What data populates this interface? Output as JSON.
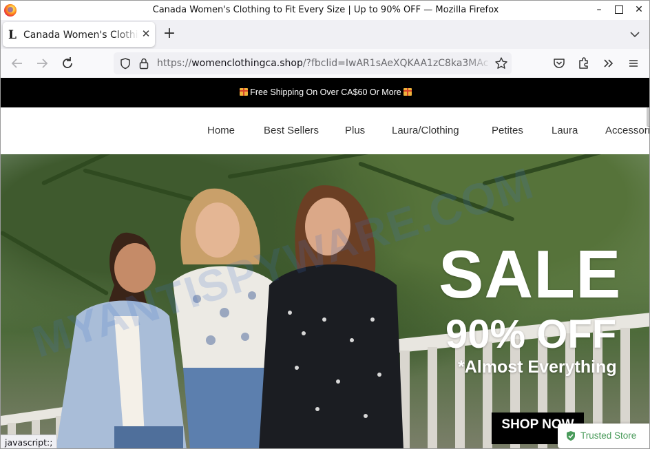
{
  "window": {
    "title": "Canada Women's Clothing to Fit Every Size | Up to 90% OFF — Mozilla Firefox",
    "min_label": "–",
    "close_label": "✕"
  },
  "tabs": [
    {
      "favicon_letter": "L",
      "title": "Canada Women's Clothing to Fit Every Size",
      "close_label": "✕"
    }
  ],
  "newtab_label": "+",
  "navbar": {
    "url_domain": "womenclothingca.shop",
    "url_prefix": "https://",
    "url_suffix": "/?fbclid=IwAR1sAeXQKAA1zC8ka3MAc"
  },
  "page": {
    "announcement": "Free Shipping On Over CA$60 Or More",
    "nav_items": [
      "Home",
      "Best Sellers",
      "Plus",
      "Laura/Clothing",
      "Petites",
      "Laura",
      "Accessories"
    ],
    "hero": {
      "sale": "SALE",
      "off": "90% OFF",
      "almost": "*Almost Everything",
      "cta": "SHOP NOW",
      "watermark": "MYANTISPYWARE.COM"
    },
    "trusted_badge": "Trusted Store"
  },
  "statusbar": "javascript:;",
  "colors": {
    "announce_bg": "#000000",
    "trusted_green": "#4a9b5b",
    "cta_bg": "#000000"
  }
}
